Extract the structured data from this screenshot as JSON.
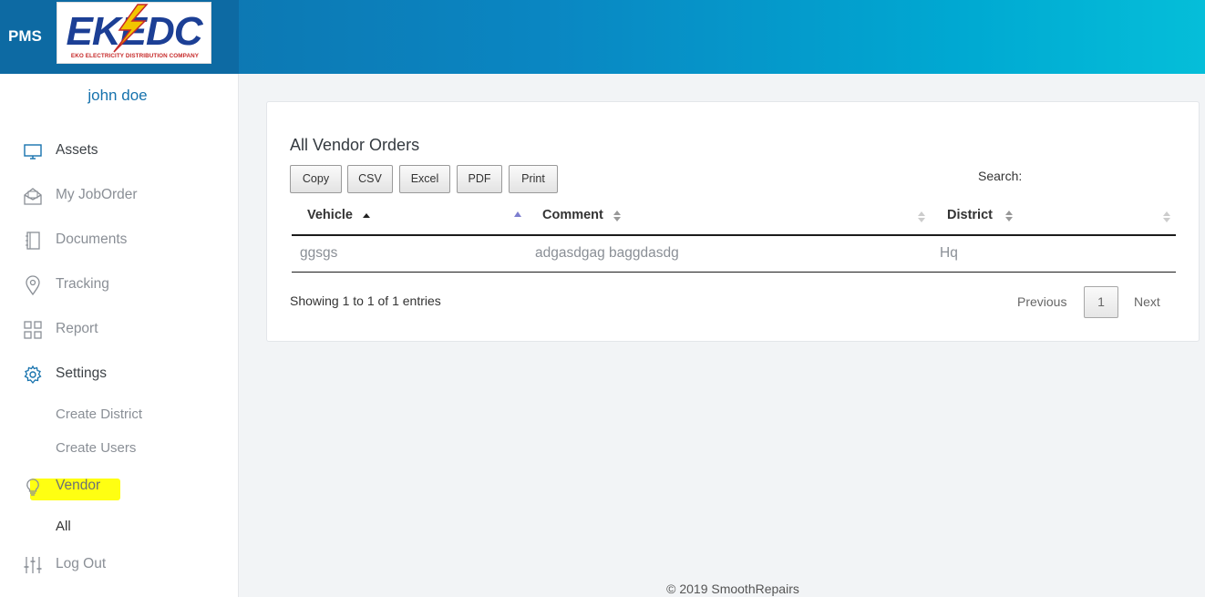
{
  "header": {
    "app_name": "PMS",
    "logo_text": "EKEDC",
    "logo_subtitle": "EKO ELECTRICITY DISTRIBUTION COMPANY"
  },
  "sidebar": {
    "user_name": "john doe",
    "items": [
      {
        "label": "Assets",
        "icon": "monitor-icon"
      },
      {
        "label": "My JobOrder",
        "icon": "envelope-open-icon"
      },
      {
        "label": "Documents",
        "icon": "notebook-icon"
      },
      {
        "label": "Tracking",
        "icon": "map-pin-icon"
      },
      {
        "label": "Report",
        "icon": "grid-icon"
      },
      {
        "label": "Settings",
        "icon": "gear-icon"
      },
      {
        "label": "Vendor",
        "icon": "lightbulb-icon"
      },
      {
        "label": "Log Out",
        "icon": "sliders-icon"
      }
    ],
    "settings_sub": [
      "Create District",
      "Create Users"
    ],
    "vendor_sub": [
      "All"
    ],
    "highlight_color": "#ffff12"
  },
  "main": {
    "title": "All Vendor Orders",
    "export_buttons": [
      "Copy",
      "CSV",
      "Excel",
      "PDF",
      "Print"
    ],
    "search_label": "Search:",
    "table": {
      "columns": [
        "Vehicle",
        "Comment",
        "District"
      ],
      "sorted_column": "Vehicle",
      "sort_direction": "ascending",
      "rows": [
        [
          "ggsgs",
          "adgasdgag baggdasdg",
          "Hq"
        ]
      ]
    },
    "info": "Showing 1 to 1 of 1 entries",
    "pagination": {
      "previous": "Previous",
      "current_page": "1",
      "next": "Next"
    }
  },
  "footer": {
    "text": "© 2019 SmoothRepairs"
  },
  "colors": {
    "header_gradient_start": "#0f6ea8",
    "header_gradient_end": "#05bed9",
    "accent": "#1672ad",
    "logo_red": "#c62828",
    "logo_blue": "#1c3f95"
  }
}
